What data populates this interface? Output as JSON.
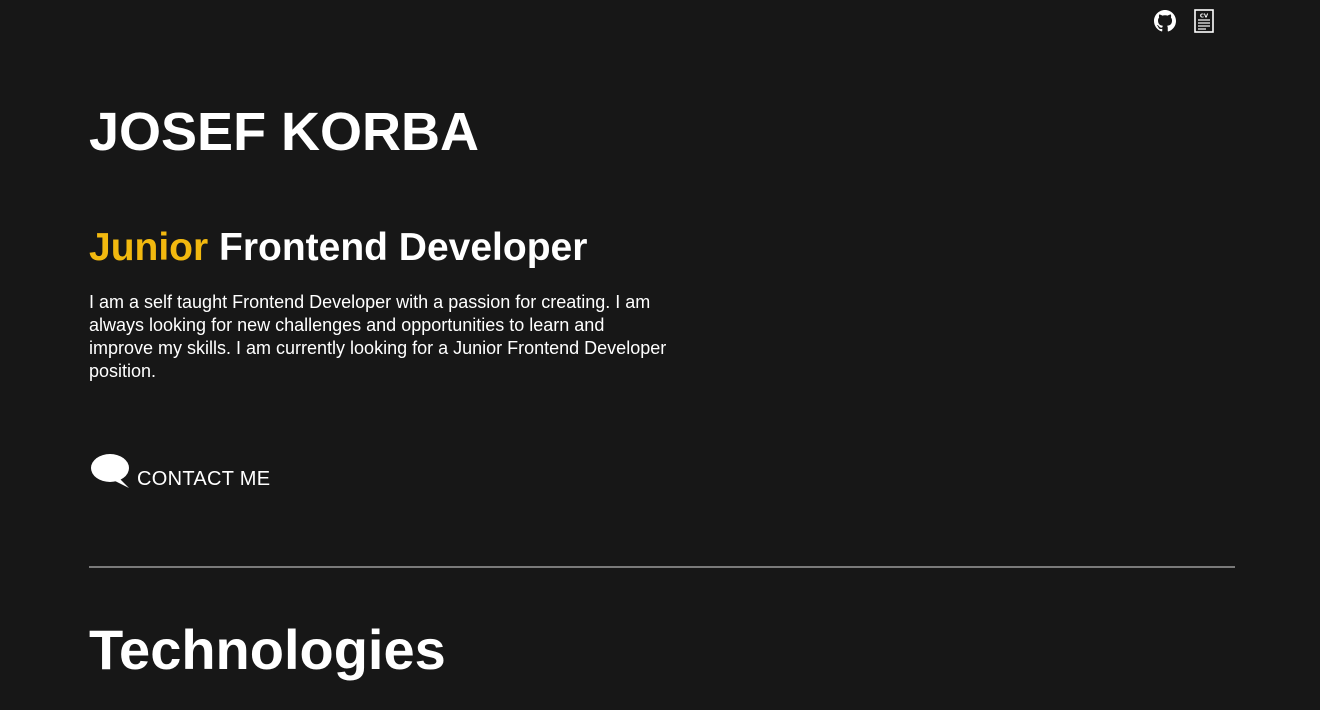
{
  "header": {
    "icons": [
      {
        "name": "github-icon",
        "label": "GitHub"
      },
      {
        "name": "cv-icon",
        "label": "CV"
      }
    ]
  },
  "hero": {
    "name": "JOSEF KORBA",
    "role_accent": "Junior",
    "role_rest": " Frontend Developer",
    "bio": "I am a self taught Frontend Developer with a passion for creating. I am always looking for new challenges and opportunities to learn and improve my skills. I am currently looking for a Junior Frontend Developer position.",
    "contact_label": "CONTACT ME",
    "contact_icon": "speech-bubble-icon"
  },
  "technologies": {
    "title": "Technologies"
  },
  "colors": {
    "background": "#171717",
    "text": "#ffffff",
    "accent": "#f2b90f",
    "divider": "#7a7a7a"
  }
}
